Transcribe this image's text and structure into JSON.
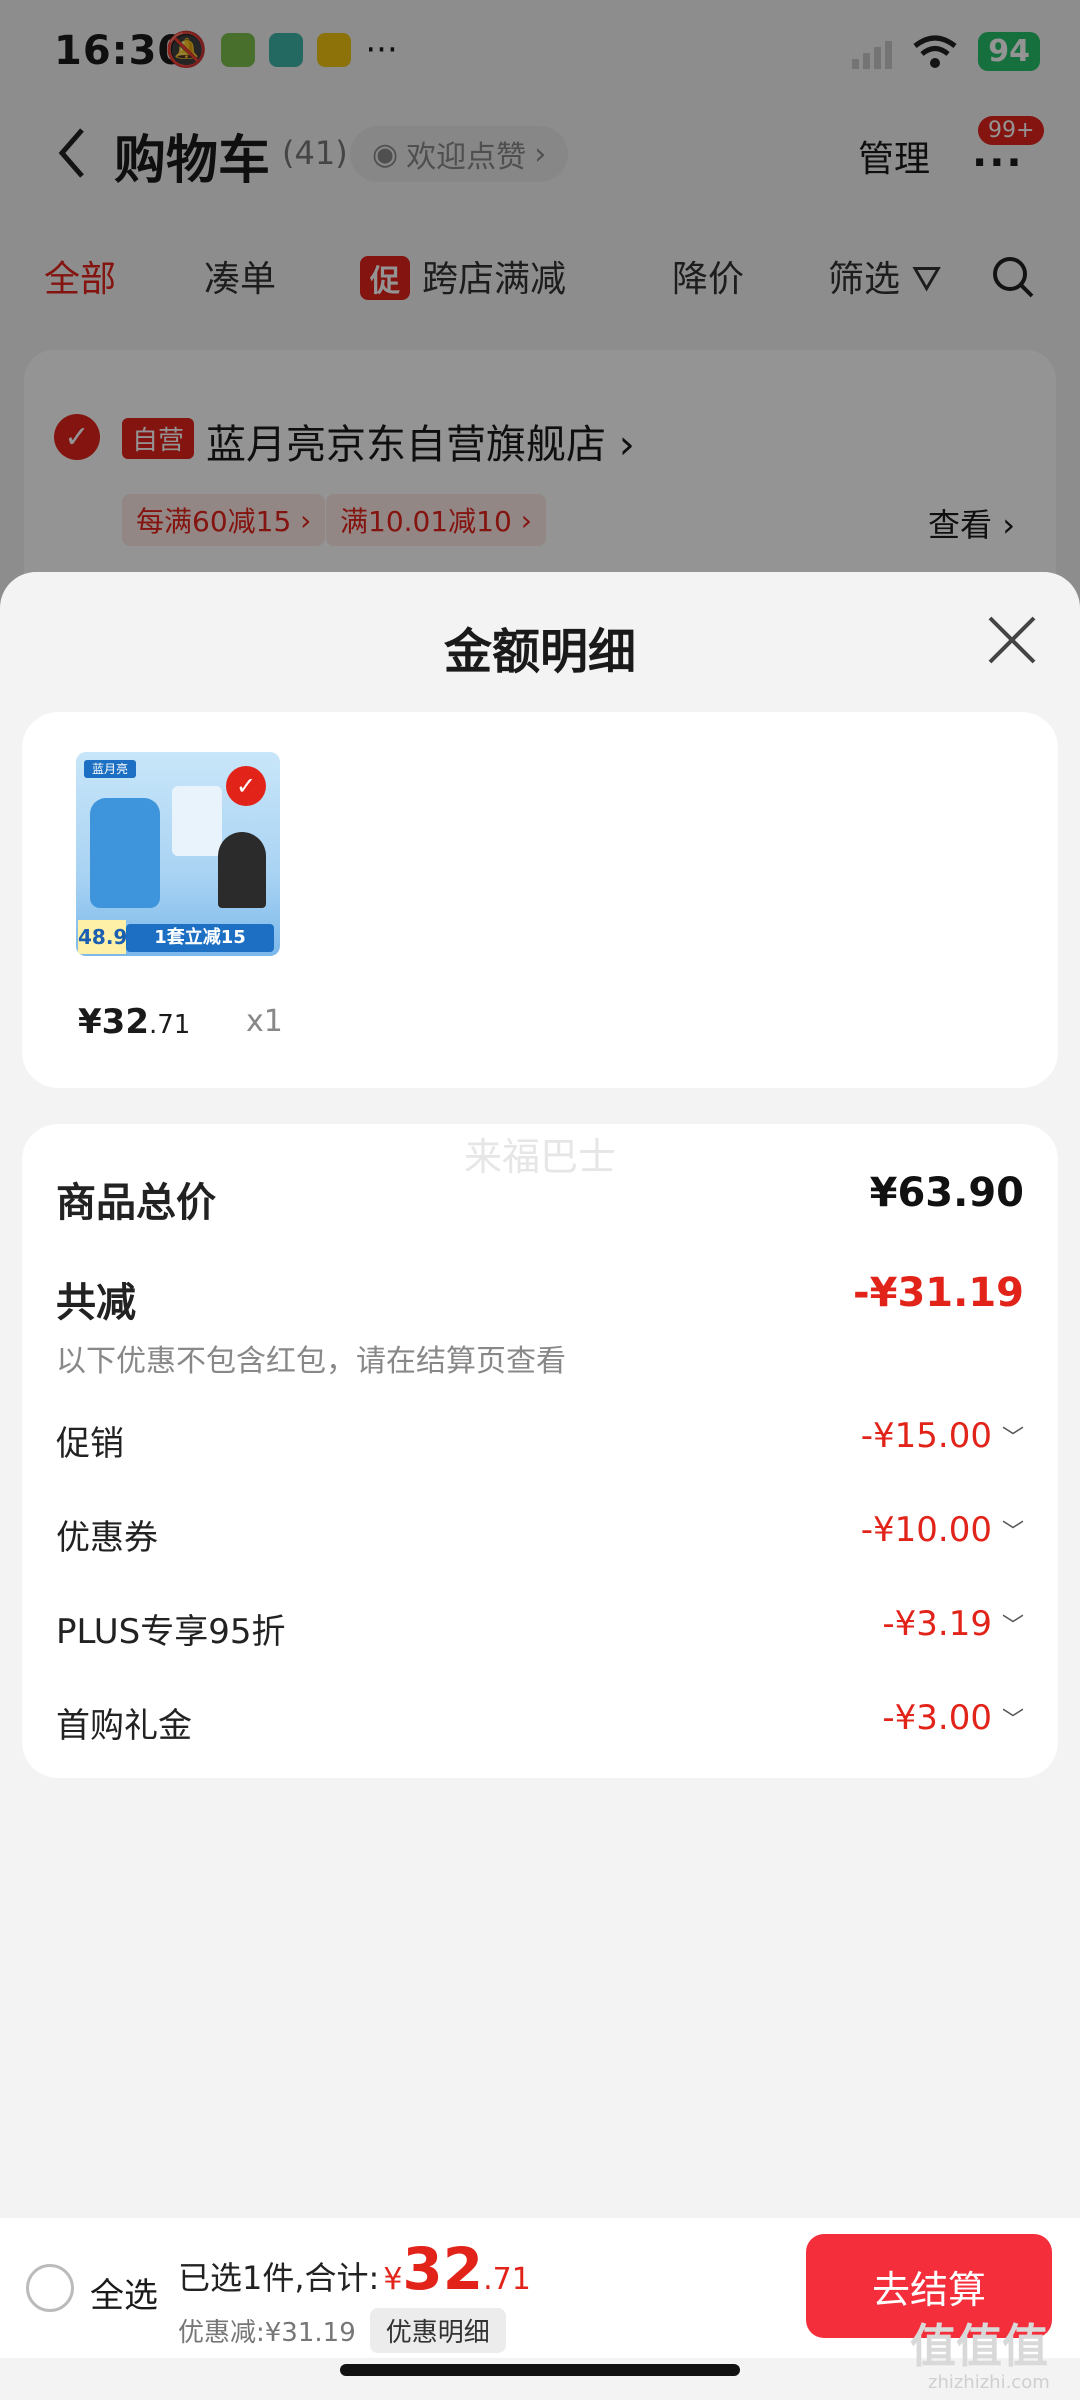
{
  "status_bar": {
    "time": "16:30",
    "more": "···",
    "battery": "94"
  },
  "nav": {
    "title": "购物车",
    "count": "(41)",
    "like_label": "欢迎点赞",
    "manage": "管理",
    "msg_badge": "99+"
  },
  "tabs": [
    {
      "label": "全部",
      "active": true
    },
    {
      "label": "凑单"
    },
    {
      "label": "跨店满减",
      "tag": "促"
    },
    {
      "label": "降价"
    },
    {
      "label": "筛选"
    }
  ],
  "store": {
    "tag": "自营",
    "name": "蓝月亮京东自营旗舰店",
    "promos": [
      "每满60减15",
      "满10.01减10"
    ],
    "view": "查看"
  },
  "sheet": {
    "title": "金额明细",
    "product": {
      "price_int": "¥32",
      "price_dec": ".71",
      "qty": "x1",
      "image_text": {
        "brand": "蓝月亮",
        "price": "48.9",
        "promo": "1套立减15"
      }
    },
    "watermark": "来福巴士",
    "total_label": "商品总价",
    "total_value": "¥63.90",
    "discount_label": "共减",
    "discount_value": "-¥31.19",
    "discount_note": "以下优惠不包含红包，请在结算页查看",
    "items": [
      {
        "label": "促销",
        "value": "-¥15.00"
      },
      {
        "label": "优惠券",
        "value": "-¥10.00"
      },
      {
        "label": "PLUS专享95折",
        "value": "-¥3.19"
      },
      {
        "label": "首购礼金",
        "value": "-¥3.00"
      }
    ]
  },
  "bottom": {
    "select_all": "全选",
    "selected_text": "已选1件,合计:",
    "yen": "¥",
    "amount_int": "32",
    "amount_dec": ".71",
    "discount_text": "优惠减:¥31.19",
    "discount_detail": "优惠明细",
    "checkout": "去结算"
  },
  "corner_watermark": {
    "logo": "值值值",
    "site": "zhizhizhi.com"
  },
  "colors": {
    "accent": "#e2231a",
    "checkout": "#f52e3b"
  }
}
